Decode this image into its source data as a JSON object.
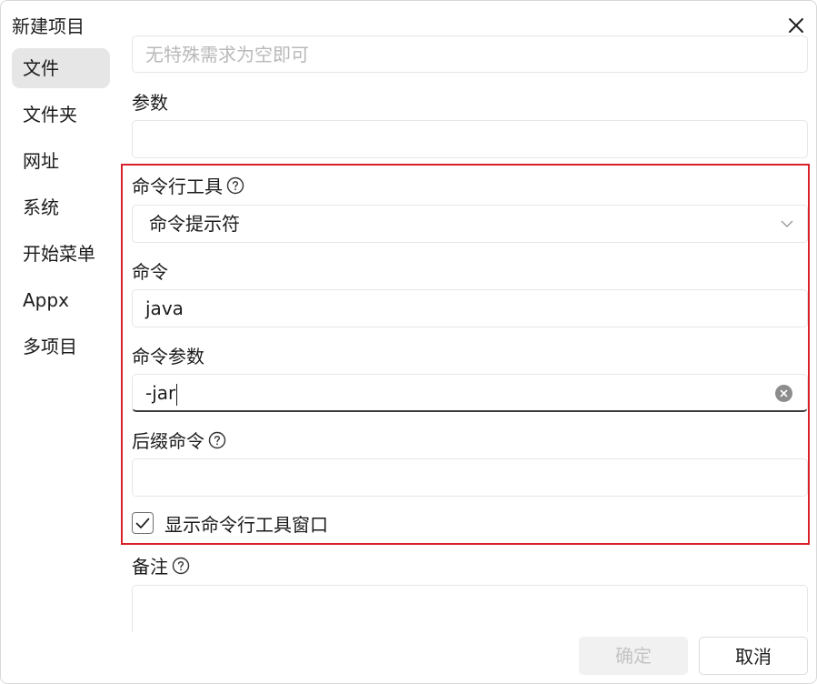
{
  "dialog": {
    "title": "新建项目",
    "close_icon": "close-icon"
  },
  "sidebar": {
    "items": [
      {
        "label": "文件",
        "active": true
      },
      {
        "label": "文件夹"
      },
      {
        "label": "网址"
      },
      {
        "label": "系统"
      },
      {
        "label": "开始菜单"
      },
      {
        "label": "Appx"
      },
      {
        "label": "多项目"
      }
    ]
  },
  "form": {
    "top_field_placeholder": "无特殊需求为空即可",
    "params_label": "参数",
    "params_value": "",
    "cli_tool_label": "命令行工具",
    "cli_tool_value": "命令提示符",
    "command_label": "命令",
    "command_value": "java",
    "command_args_label": "命令参数",
    "command_args_value": "-jar",
    "suffix_label": "后缀命令",
    "suffix_value": "",
    "show_cli_window_label": "显示命令行工具窗口",
    "show_cli_window_checked": true,
    "notes_label": "备注",
    "notes_value": ""
  },
  "footer": {
    "ok_label": "确定",
    "cancel_label": "取消"
  },
  "colors": {
    "highlight_border": "#d92228",
    "active_sidebar_bg": "#e6e6e6"
  }
}
